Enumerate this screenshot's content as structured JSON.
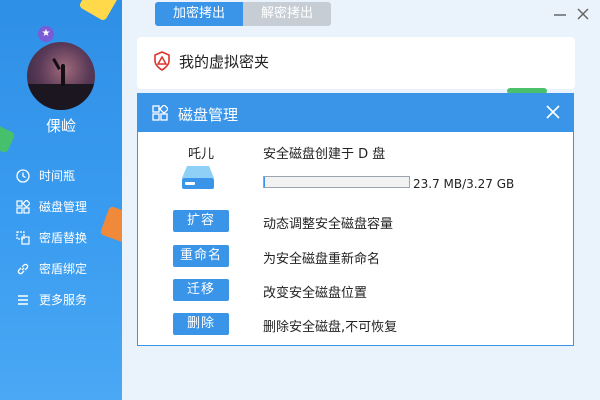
{
  "sidebar": {
    "username": "倮崄",
    "items": [
      {
        "label": "时间瓶",
        "icon": "clock-icon"
      },
      {
        "label": "磁盘管理",
        "icon": "grid-icon"
      },
      {
        "label": "密盾替换",
        "icon": "swap-icon"
      },
      {
        "label": "密盾绑定",
        "icon": "link-icon"
      },
      {
        "label": "更多服务",
        "icon": "menu-icon"
      }
    ]
  },
  "tabs": [
    {
      "label": "加密拷出",
      "active": true
    },
    {
      "label": "解密拷出",
      "active": false
    }
  ],
  "card": {
    "title": "我的虚拟密夹"
  },
  "dialog": {
    "title": "磁盘管理",
    "disk_name": "吒儿",
    "disk_info": "安全磁盘创建于 D 盘",
    "usage_fraction": 0.007,
    "size_text": "23.7 MB/3.27 GB",
    "actions": [
      {
        "label": "扩容",
        "desc": "动态调整安全磁盘容量"
      },
      {
        "label": "重命名",
        "desc": "为安全磁盘重新命名"
      },
      {
        "label": "迁移",
        "desc": "改变安全磁盘位置"
      },
      {
        "label": "删除",
        "desc": "删除安全磁盘,不可恢复"
      }
    ]
  },
  "colors": {
    "accent": "#3a95e8",
    "sidebar": "#2e8fe6"
  }
}
